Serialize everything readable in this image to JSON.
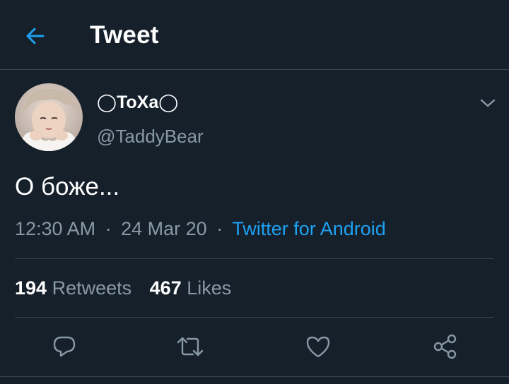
{
  "header": {
    "title": "Tweet",
    "back_icon": "arrow-left-icon"
  },
  "tweet": {
    "author": {
      "display_name": "◯ToXa◯",
      "handle": "@TaddyBear"
    },
    "text": "О боже...",
    "time": "12:30 AM",
    "date": "24 Mar 20",
    "separator": "·",
    "source": "Twitter for Android",
    "stats": {
      "retweets_count": "194",
      "retweets_label": "Retweets",
      "likes_count": "467",
      "likes_label": "Likes"
    },
    "actions": [
      "reply-icon",
      "retweet-icon",
      "like-icon",
      "share-icon"
    ]
  },
  "colors": {
    "background": "#15202b",
    "accent": "#1da1f2",
    "secondary_text": "#8899a6",
    "divider": "#38444d"
  }
}
